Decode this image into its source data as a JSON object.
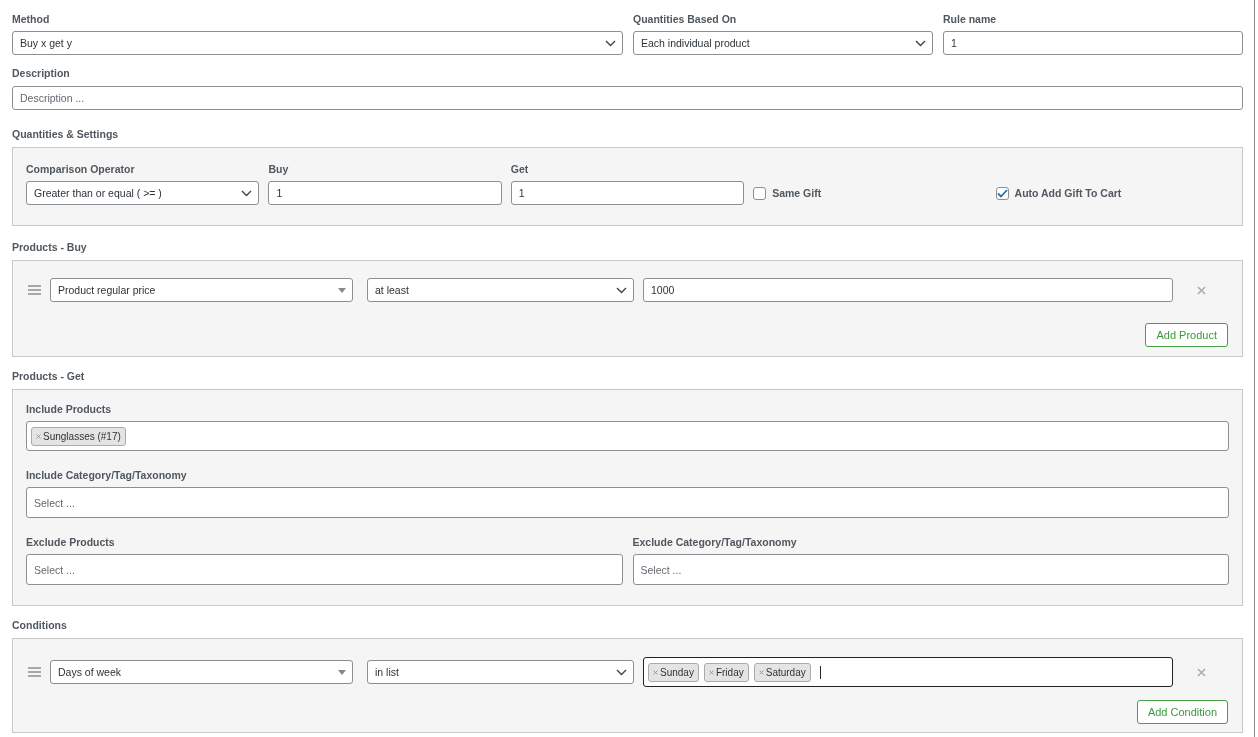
{
  "method": {
    "label": "Method",
    "value": "Buy x get y"
  },
  "quantities_based_on": {
    "label": "Quantities Based On",
    "value": "Each individual product"
  },
  "rule_name": {
    "label": "Rule name",
    "value": "1"
  },
  "description": {
    "label": "Description",
    "placeholder": "Description ..."
  },
  "quantities_settings": {
    "title": "Quantities & Settings",
    "comparison_operator": {
      "label": "Comparison Operator",
      "value": "Greater than or equal ( >= )"
    },
    "buy": {
      "label": "Buy",
      "value": "1"
    },
    "get": {
      "label": "Get",
      "value": "1"
    },
    "options": [
      {
        "label": "Same Gift",
        "checked": false
      },
      {
        "label": "Auto Add Gift To Cart",
        "checked": true
      }
    ]
  },
  "products_buy": {
    "title": "Products - Buy",
    "rows": [
      {
        "kind": "input",
        "field": "Product regular price",
        "operator": "at least",
        "value": "1000"
      }
    ],
    "add_button": "Add Product"
  },
  "products_get": {
    "title": "Products - Get",
    "include_products": {
      "label": "Include Products",
      "tags": [
        "Sunglasses (#17)"
      ]
    },
    "include_category": {
      "label": "Include Category/Tag/Taxonomy",
      "placeholder": "Select ..."
    },
    "exclude_products": {
      "label": "Exclude Products",
      "placeholder": "Select ..."
    },
    "exclude_category": {
      "label": "Exclude Category/Tag/Taxonomy",
      "placeholder": "Select ..."
    }
  },
  "conditions": {
    "title": "Conditions",
    "rows": [
      {
        "kind": "tags",
        "field": "Days of week",
        "operator": "in list",
        "tags": [
          "Sunday",
          "Friday",
          "Saturday"
        ],
        "focused": true
      }
    ],
    "add_button": "Add Condition"
  }
}
